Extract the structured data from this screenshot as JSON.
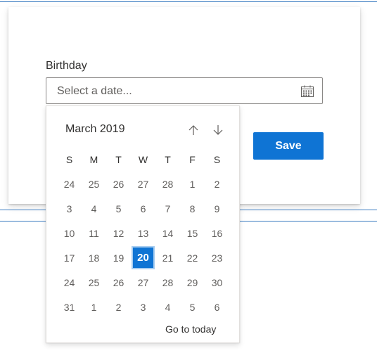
{
  "form": {
    "field_label": "Birthday",
    "date_placeholder": "Select a date...",
    "save_label": "Save"
  },
  "calendar": {
    "month_year": "March 2019",
    "weekdays": [
      "S",
      "M",
      "T",
      "W",
      "T",
      "F",
      "S"
    ],
    "weeks": [
      [
        "24",
        "25",
        "26",
        "27",
        "28",
        "1",
        "2"
      ],
      [
        "3",
        "4",
        "5",
        "6",
        "7",
        "8",
        "9"
      ],
      [
        "10",
        "11",
        "12",
        "13",
        "14",
        "15",
        "16"
      ],
      [
        "17",
        "18",
        "19",
        "20",
        "21",
        "22",
        "23"
      ],
      [
        "24",
        "25",
        "26",
        "27",
        "28",
        "29",
        "30"
      ],
      [
        "31",
        "1",
        "2",
        "3",
        "4",
        "5",
        "6"
      ]
    ],
    "selected_day": "20",
    "go_to_today_label": "Go to today"
  },
  "colors": {
    "accent": "#0f74d4",
    "text": "#323130",
    "muted_text": "#605e5c",
    "border": "#8a8886",
    "rule_line": "#3b7bc0"
  },
  "icons": {
    "calendar": "calendar-icon",
    "previous_month": "arrow-up-icon",
    "next_month": "arrow-down-icon"
  }
}
